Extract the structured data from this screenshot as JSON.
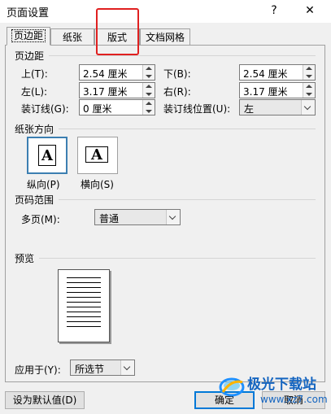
{
  "window": {
    "title": "页面设置",
    "help": "?",
    "close": "✕"
  },
  "tabs": [
    {
      "label": "页边距"
    },
    {
      "label": "纸张"
    },
    {
      "label": "版式"
    },
    {
      "label": "文档网格"
    }
  ],
  "margins": {
    "section_title": "页边距",
    "top_label": "上(T):",
    "top_value": "2.54 厘米",
    "bottom_label": "下(B):",
    "bottom_value": "2.54 厘米",
    "left_label": "左(L):",
    "left_value": "3.17 厘米",
    "right_label": "右(R):",
    "right_value": "3.17 厘米",
    "gutter_label": "装订线(G):",
    "gutter_value": "0 厘米",
    "gutter_pos_label": "装订线位置(U):",
    "gutter_pos_value": "左"
  },
  "orientation": {
    "section_title": "纸张方向",
    "portrait_label": "纵向(P)",
    "landscape_label": "横向(S)",
    "glyph": "A"
  },
  "pages": {
    "section_title": "页码范围",
    "multiple_label": "多页(M):",
    "multiple_value": "普通"
  },
  "preview": {
    "section_title": "预览"
  },
  "apply": {
    "label": "应用于(Y):",
    "value": "所选节"
  },
  "footer": {
    "default_button": "设为默认值(D)",
    "ok_button": "确定",
    "cancel_button": "取消"
  },
  "watermark": {
    "text": "极光下载站",
    "url": "www.xz7.com"
  },
  "colors": {
    "highlight": "#e02020",
    "accent": "#0078d7"
  }
}
